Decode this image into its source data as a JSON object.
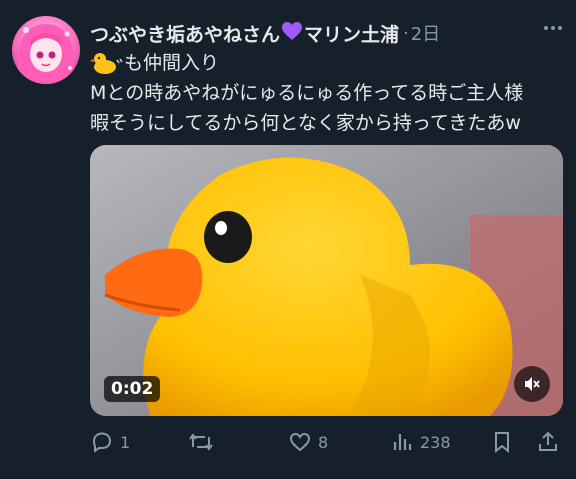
{
  "tweet": {
    "display_name": "つぶやき垢あやねさん",
    "name_suffix": "マリン土浦",
    "separator": "·",
    "timestamp": "2日",
    "text_line1": "も仲間入り",
    "text_line2": "Mとの時あやねがにゅるにゅる作ってる時ご主人様",
    "text_line3": "暇そうにしてるから何となく家から持ってきたあw"
  },
  "media": {
    "duration": "0:02"
  },
  "actions": {
    "reply_count": "1",
    "retweet_count": "",
    "like_count": "8",
    "views_count": "238"
  },
  "icons": {
    "avatar": "avatar-image",
    "heart": "purple-heart-icon",
    "duck": "duck-emoji-icon",
    "more": "more-icon",
    "mute": "mute-icon",
    "reply": "reply-icon",
    "retweet": "retweet-icon",
    "like": "like-icon",
    "views": "views-icon",
    "bookmark": "bookmark-icon",
    "share": "share-icon"
  },
  "colors": {
    "background": "#15202b",
    "text": "#e7e9ea",
    "muted": "#8b98a5",
    "heart": "#a259ff",
    "duck": "#ffc21a",
    "beak": "#ff7a12"
  }
}
